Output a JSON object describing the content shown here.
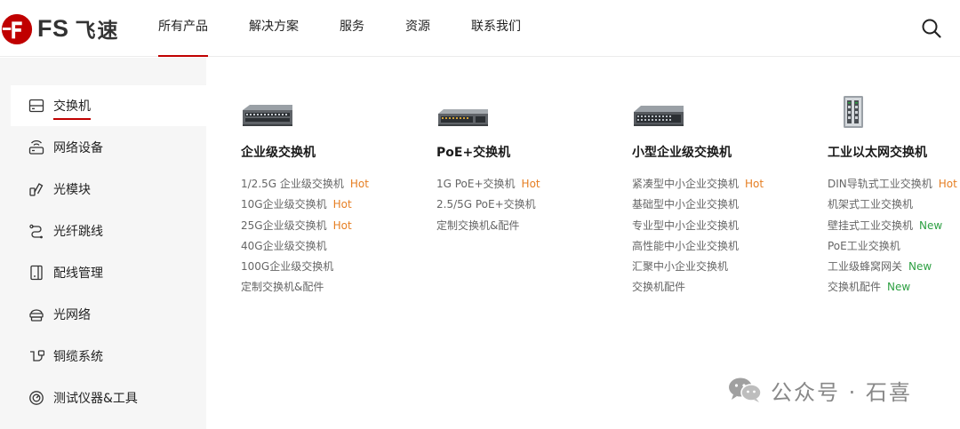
{
  "brand": {
    "logo_text": "FS",
    "logo_cn": "飞速",
    "accent": "#c00000"
  },
  "nav": {
    "items": [
      {
        "label": "所有产品",
        "active": true
      },
      {
        "label": "解决方案"
      },
      {
        "label": "服务"
      },
      {
        "label": "资源"
      },
      {
        "label": "联系我们"
      }
    ],
    "search_icon": "search-icon"
  },
  "sidebar": {
    "items": [
      {
        "label": "交换机",
        "icon": "switch-icon",
        "active": true
      },
      {
        "label": "网络设备",
        "icon": "router-icon"
      },
      {
        "label": "光模块",
        "icon": "transceiver-icon"
      },
      {
        "label": "光纤跳线",
        "icon": "fiber-cable-icon"
      },
      {
        "label": "配线管理",
        "icon": "patch-panel-icon"
      },
      {
        "label": "光网络",
        "icon": "optical-network-icon"
      },
      {
        "label": "铜缆系统",
        "icon": "copper-cable-icon"
      },
      {
        "label": "测试仪器&工具",
        "icon": "test-tool-icon"
      }
    ]
  },
  "categories": [
    {
      "title": "企业级交换机",
      "image": "enterprise-switch-image",
      "links": [
        {
          "label": "1/2.5G 企业级交换机",
          "badge": "Hot"
        },
        {
          "label": "10G企业级交换机",
          "badge": "Hot"
        },
        {
          "label": "25G企业级交换机",
          "badge": "Hot"
        },
        {
          "label": "40G企业级交换机",
          "badge": ""
        },
        {
          "label": "100G企业级交换机",
          "badge": ""
        },
        {
          "label": "定制交换机&配件",
          "badge": ""
        }
      ]
    },
    {
      "title": "PoE+交换机",
      "image": "poe-switch-image",
      "links": [
        {
          "label": "1G PoE+交换机",
          "badge": "Hot"
        },
        {
          "label": "2.5/5G PoE+交换机",
          "badge": ""
        },
        {
          "label": "定制交换机&配件",
          "badge": ""
        }
      ]
    },
    {
      "title": "小型企业级交换机",
      "image": "smb-switch-image",
      "links": [
        {
          "label": "紧凑型中小企业交换机",
          "badge": "Hot"
        },
        {
          "label": "基础型中小企业交换机",
          "badge": ""
        },
        {
          "label": "专业型中小企业交换机",
          "badge": ""
        },
        {
          "label": "高性能中小企业交换机",
          "badge": ""
        },
        {
          "label": "汇聚中小企业交换机",
          "badge": ""
        },
        {
          "label": "交换机配件",
          "badge": ""
        }
      ]
    },
    {
      "title": "工业以太网交换机",
      "image": "industrial-switch-image",
      "links": [
        {
          "label": "DIN导轨式工业交换机",
          "badge": "Hot"
        },
        {
          "label": "机架式工业交换机",
          "badge": ""
        },
        {
          "label": "壁挂式工业交换机",
          "badge": "New"
        },
        {
          "label": "PoE工业交换机",
          "badge": ""
        },
        {
          "label": "工业级蜂窝网关",
          "badge": "New"
        },
        {
          "label": "交换机配件",
          "badge": "New"
        }
      ]
    }
  ],
  "watermark": {
    "text": "公众号 · 石喜",
    "icon": "wechat-icon"
  }
}
